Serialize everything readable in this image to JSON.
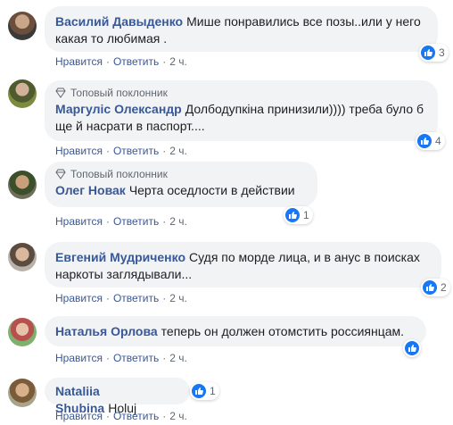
{
  "comments": [
    {
      "author": "Василий Давыденко",
      "badge": "",
      "text": "Мише понравились все позы..или у него какая то любимая .",
      "likes": "3",
      "like_label": "Нравится",
      "reply_label": "Ответить",
      "time": "2 ч."
    },
    {
      "author": "Маргуліс Олександр",
      "badge": "Топовый поклонник",
      "text": "Долбодупкіна принизили)))) треба було б ще й насрати в паспорт....",
      "likes": "4",
      "like_label": "Нравится",
      "reply_label": "Ответить",
      "time": "2 ч."
    },
    {
      "author": "Олег Новак",
      "badge": "Топовый поклонник",
      "text": "Черта оседлости в действии",
      "likes": "1",
      "like_label": "Нравится",
      "reply_label": "Ответить",
      "time": "2 ч."
    },
    {
      "author": "Евгений Мудриченко",
      "badge": "",
      "text": "Судя по морде лица, и в анус в поисках наркоты заглядывали...",
      "likes": "2",
      "like_label": "Нравится",
      "reply_label": "Ответить",
      "time": "2 ч."
    },
    {
      "author": "Наталья Орлова",
      "badge": "",
      "text": "теперь он должен отомстить россиянцам.",
      "likes": "",
      "like_label": "Нравится",
      "reply_label": "Ответить",
      "time": "2 ч."
    },
    {
      "author": "Nataliia Shubina",
      "badge": "",
      "text": "Holuj",
      "likes": "1",
      "like_label": "Нравится",
      "reply_label": "Ответить",
      "time": "2 ч."
    }
  ],
  "colors": {
    "author": "#385898",
    "bubble": "#f2f3f5",
    "like": "#1877f2",
    "meta": "#606770"
  },
  "icons": [
    "diamond-icon",
    "like-icon",
    "avatar"
  ]
}
